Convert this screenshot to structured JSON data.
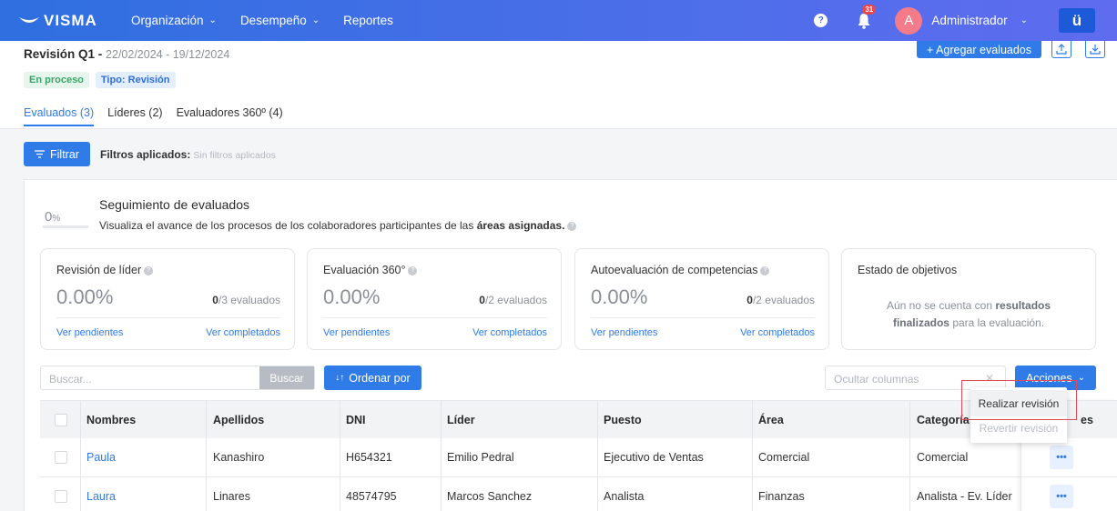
{
  "topbar": {
    "logo": "VISMA",
    "nav": [
      "Organización",
      "Desempeño",
      "Reportes"
    ],
    "help_icon": "?",
    "notifications_count": "31",
    "avatar_letter": "A",
    "user_name": "Administrador",
    "app_switch_label": "ü"
  },
  "header": {
    "title": "Revisión Q1 -",
    "dates": "22/02/2024 - 19/12/2024",
    "status_badge": "En proceso",
    "type_badge": "Tipo: Revisión",
    "add_button": "+ Agregar evaluados",
    "tabs": [
      {
        "label": "Evaluados (3)",
        "active": true
      },
      {
        "label": "Líderes (2)",
        "active": false
      },
      {
        "label": "Evaluadores 360º (4)",
        "active": false
      }
    ]
  },
  "filters": {
    "button": "Filtrar",
    "applied_label": "Filtros aplicados:",
    "applied_value": "Sin filtros aplicados"
  },
  "tracking": {
    "percent": "0",
    "percent_suffix": "%",
    "title": "Seguimiento de evaluados",
    "desc_prefix": "Visualiza el avance de los procesos de los colaboradores participantes de las",
    "desc_bold": "áreas asignadas.",
    "cards": [
      {
        "title": "Revisión de líder",
        "value": "0.00%",
        "count_done": "0",
        "count_rest": "/3 evaluados",
        "link1": "Ver pendientes",
        "link2": "Ver completados"
      },
      {
        "title": "Evaluación 360°",
        "value": "0.00%",
        "count_done": "0",
        "count_rest": "/2 evaluados",
        "link1": "Ver pendientes",
        "link2": "Ver completados"
      },
      {
        "title": "Autoevaluación de competencias",
        "value": "0.00%",
        "count_done": "0",
        "count_rest": "/2 evaluados",
        "link1": "Ver pendientes",
        "link2": "Ver completados"
      }
    ],
    "objectives": {
      "title": "Estado de objetivos",
      "msg_a": "Aún no se cuenta con",
      "msg_b": "resultados finalizados",
      "msg_c": "para la evaluación."
    }
  },
  "toolbar": {
    "search_placeholder": "Buscar...",
    "search_button": "Buscar",
    "order_button": "Ordenar por",
    "hide_columns_placeholder": "Ocultar columnas",
    "actions_button": "Acciones"
  },
  "table": {
    "headers": [
      "Nombres",
      "Apellidos",
      "DNI",
      "Líder",
      "Puesto",
      "Área",
      "Categoría j",
      "es"
    ],
    "rows": [
      [
        "Paula",
        "Kanashiro",
        "H654321",
        "Emilio Pedral",
        "Ejecutivo de Ventas",
        "Comercial",
        "Comercial"
      ],
      [
        "Laura",
        "Linares",
        "48574795",
        "Marcos Sanchez",
        "Analista",
        "Finanzas",
        "Analista - Ev. Líder"
      ]
    ],
    "more_label": "•••"
  },
  "dropdown": {
    "items": [
      "Realizar revisión",
      "Revertir revisión"
    ]
  }
}
